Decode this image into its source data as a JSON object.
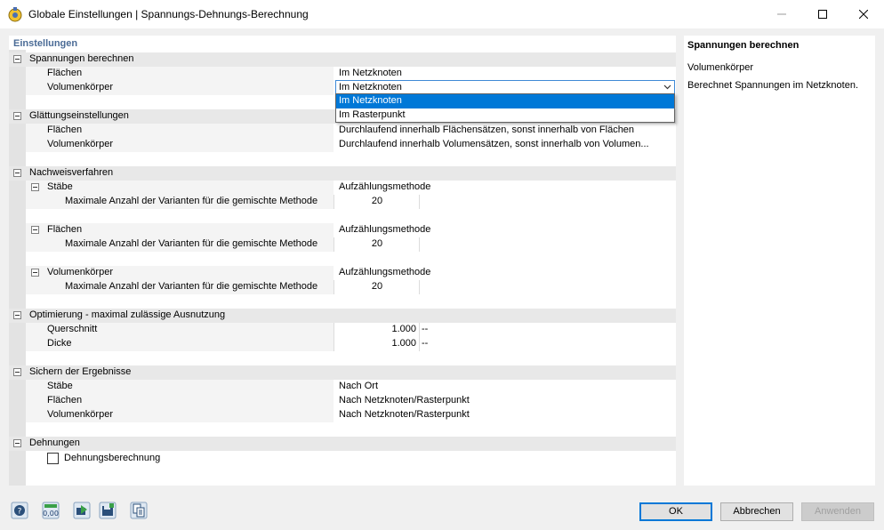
{
  "window": {
    "title": "Globale Einstellungen | Spannungs-Dehnungs-Berechnung"
  },
  "left": {
    "header": "Einstellungen",
    "cat_spannungen": "Spannungen berechnen",
    "flaechen": "Flächen",
    "flaechen_val": "Im Netzknoten",
    "volumen": "Volumenkörper",
    "volumen_val": "Im Netzknoten",
    "dropdown_options": [
      "Im Netzknoten",
      "Im Rasterpunkt"
    ],
    "cat_glaettung": "Glättungseinstellungen",
    "g_flaechen": "Flächen",
    "g_flaechen_val": "Durchlaufend innerhalb Flächensätzen, sonst innerhalb von Flächen",
    "g_volumen": "Volumenkörper",
    "g_volumen_val": "Durchlaufend innerhalb Volumensätzen, sonst innerhalb von Volumen...",
    "cat_nachweis": "Nachweisverfahren",
    "n_staebe": "Stäbe",
    "n_flaechen": "Flächen",
    "n_volumen": "Volumenkörper",
    "methode": "Aufzählungsmethode",
    "max_varianten": "Maximale Anzahl der Varianten für die gemischte Methode",
    "max_varianten_val": "20",
    "cat_optimierung": "Optimierung - maximal zulässige Ausnutzung",
    "querschnitt": "Querschnitt",
    "querschnitt_val": "1.000",
    "querschnitt_extra": "--",
    "dicke": "Dicke",
    "dicke_val": "1.000",
    "dicke_extra": "--",
    "cat_sichern": "Sichern der Ergebnisse",
    "s_staebe": "Stäbe",
    "s_staebe_val": "Nach Ort",
    "s_flaechen": "Flächen",
    "s_flaechen_val": "Nach Netzknoten/Rasterpunkt",
    "s_volumen": "Volumenkörper",
    "s_volumen_val": "Nach Netzknoten/Rasterpunkt",
    "cat_dehnungen": "Dehnungen",
    "dehnungsberechnung": "Dehnungsberechnung"
  },
  "right": {
    "title": "Spannungen berechnen",
    "item": "Volumenkörper",
    "description": "Berechnet Spannungen im Netzknoten."
  },
  "buttons": {
    "ok": "OK",
    "cancel": "Abbrechen",
    "apply": "Anwenden"
  },
  "toolbar_icons": [
    "help-icon",
    "number-format-icon",
    "load-icon",
    "save-icon",
    "copy-icon"
  ],
  "colors": {
    "accent": "#0078d7",
    "header": "#4a6b96"
  }
}
